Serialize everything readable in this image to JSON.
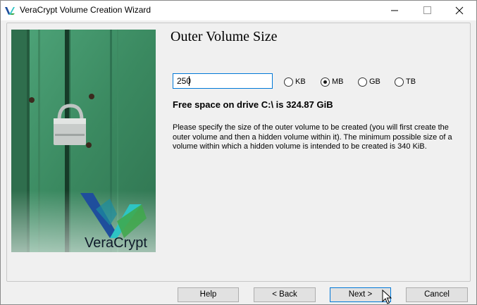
{
  "window": {
    "title": "VeraCrypt Volume Creation Wizard",
    "icon": "veracrypt-logo-icon",
    "controls": [
      "minimize-icon",
      "maximize-icon",
      "close-icon"
    ]
  },
  "banner": {
    "brand_text": "VeraCrypt",
    "image": "green-door-with-padlock"
  },
  "page": {
    "heading": "Outer Volume Size",
    "size_value": "250",
    "units": [
      {
        "label": "KB",
        "selected": false
      },
      {
        "label": "MB",
        "selected": true
      },
      {
        "label": "GB",
        "selected": false
      },
      {
        "label": "TB",
        "selected": false
      }
    ],
    "free_space": "Free space on drive C:\\ is 324.87 GiB",
    "description": "Please specify the size of the outer volume to be created (you will first create the outer volume and then a hidden volume within it). The minimum possible size of a volume within which a hidden volume is intended to be created is 340 KiB."
  },
  "buttons": {
    "help": "Help",
    "back": "< Back",
    "next": "Next >",
    "cancel": "Cancel"
  },
  "colors": {
    "accent": "#0078d7",
    "door_green": "#3d8a63",
    "logo_blue": "#1f4e9c",
    "logo_teal": "#2ec4c4",
    "logo_green": "#3ea84a"
  }
}
